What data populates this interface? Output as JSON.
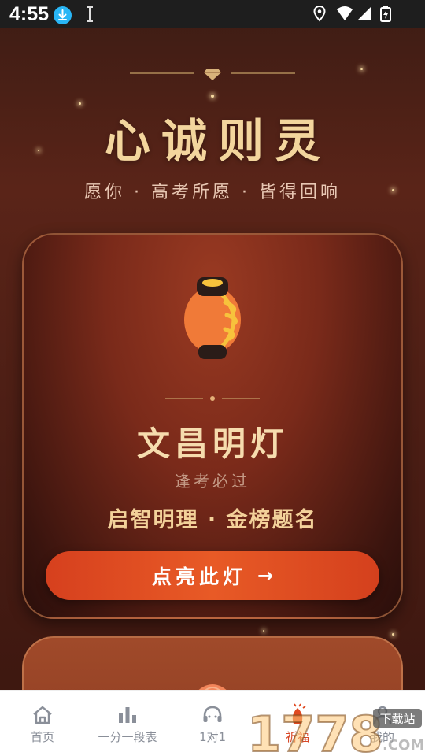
{
  "status_bar": {
    "time": "4:55",
    "icons": [
      "download-icon",
      "debug-icon",
      "location-icon",
      "wifi-icon",
      "signal-icon",
      "battery-icon"
    ]
  },
  "header": {
    "headline": "心诚则灵",
    "subline": "愿你 · 高考所愿 · 皆得回响"
  },
  "card": {
    "icon": "lantern-icon",
    "title": "文昌明灯",
    "subtitle": "逢考必过",
    "motto": "启智明理 · 金榜题名",
    "button_label": "点亮此灯",
    "button_arrow": "→"
  },
  "bottom_nav": {
    "items": [
      {
        "label": "首页",
        "icon": "home-icon"
      },
      {
        "label": "一分一段表",
        "icon": "bar-chart-icon"
      },
      {
        "label": "1对1",
        "icon": "headset-icon"
      },
      {
        "label": "祈福",
        "icon": "blessing-icon"
      },
      {
        "label": "我的",
        "icon": "profile-icon"
      }
    ]
  },
  "watermark": {
    "text": "1778",
    "suffix": ".COM",
    "tag": "下载站"
  },
  "colors": {
    "accent": "#e04a22",
    "gold": "#f3d59d",
    "background": "#4a1d14"
  }
}
